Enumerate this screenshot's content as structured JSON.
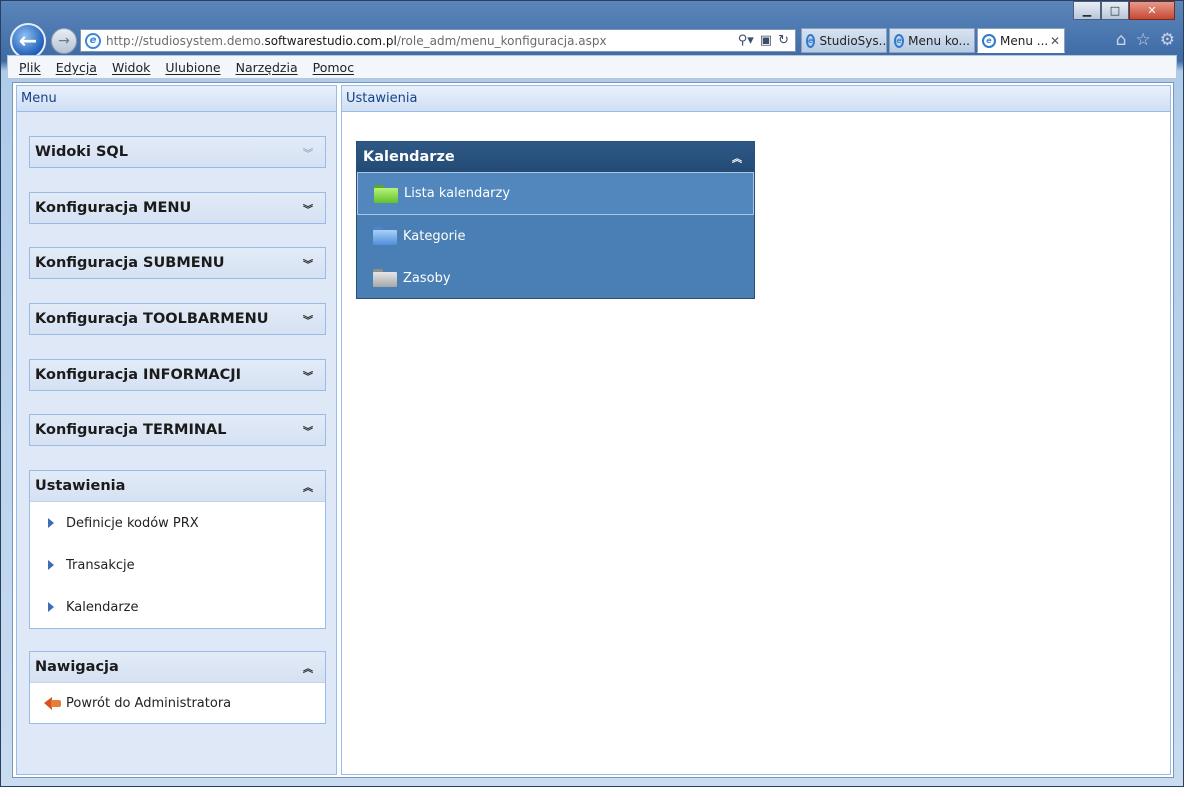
{
  "browser": {
    "url_prefix": "http://studiosystem.demo.",
    "url_domain": "softwarestudio.com.pl",
    "url_suffix": "/role_adm/menu_konfiguracja.aspx",
    "tabs": [
      {
        "label": "StudioSys...",
        "active": false
      },
      {
        "label": "Menu ko...",
        "active": false
      },
      {
        "label": "Menu ...",
        "active": true
      }
    ],
    "tab_close": "✕"
  },
  "menubar": [
    "Plik",
    "Edycja",
    "Widok",
    "Ulubione",
    "Narzędzia",
    "Pomoc"
  ],
  "left_panel": {
    "title": "Menu",
    "groups": [
      {
        "label": "Widoki SQL",
        "expanded": false
      },
      {
        "label": "Konfiguracja MENU",
        "expanded": false
      },
      {
        "label": "Konfiguracja SUBMENU",
        "expanded": false
      },
      {
        "label": "Konfiguracja TOOLBARMENU",
        "expanded": false
      },
      {
        "label": "Konfiguracja INFORMACJI",
        "expanded": false
      },
      {
        "label": "Konfiguracja TERMINAL",
        "expanded": false
      },
      {
        "label": "Ustawienia",
        "expanded": true,
        "items": [
          "Definicje kodów PRX",
          "Transakcje",
          "Kalendarze"
        ]
      },
      {
        "label": "Nawigacja",
        "expanded": true,
        "items": [
          "Powrót do Administratora"
        ]
      }
    ]
  },
  "right_panel": {
    "title": "Ustawienia",
    "calendar_box": {
      "title": "Kalendarze",
      "items": [
        {
          "label": "Lista kalendarzy",
          "icon": "green-folder-icon",
          "selected": true
        },
        {
          "label": "Kategorie",
          "icon": "blue-folder-icon",
          "selected": false
        },
        {
          "label": "Zasoby",
          "icon": "gray-folder-icon",
          "selected": false
        }
      ]
    }
  },
  "icons": {
    "collapsed": "»",
    "expanded": "«"
  }
}
